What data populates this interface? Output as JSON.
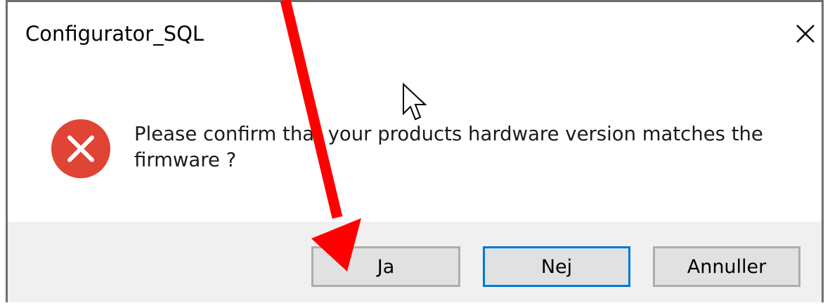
{
  "window": {
    "title": "Configurator_SQL",
    "close_icon": "close-icon"
  },
  "dialog": {
    "icon": "error-icon",
    "icon_color": "#e81123",
    "message": "Please confirm that your products hardware version matches the firmware ?"
  },
  "buttons": {
    "yes_label": "Ja",
    "no_label": "Nej",
    "cancel_label": "Annuller",
    "focused_border_color": "#0078d7"
  },
  "annotation": {
    "arrow_color": "#ff0000",
    "arrow_icon": "red-arrow-annotation"
  },
  "cursor": {
    "icon": "mouse-pointer-icon"
  }
}
